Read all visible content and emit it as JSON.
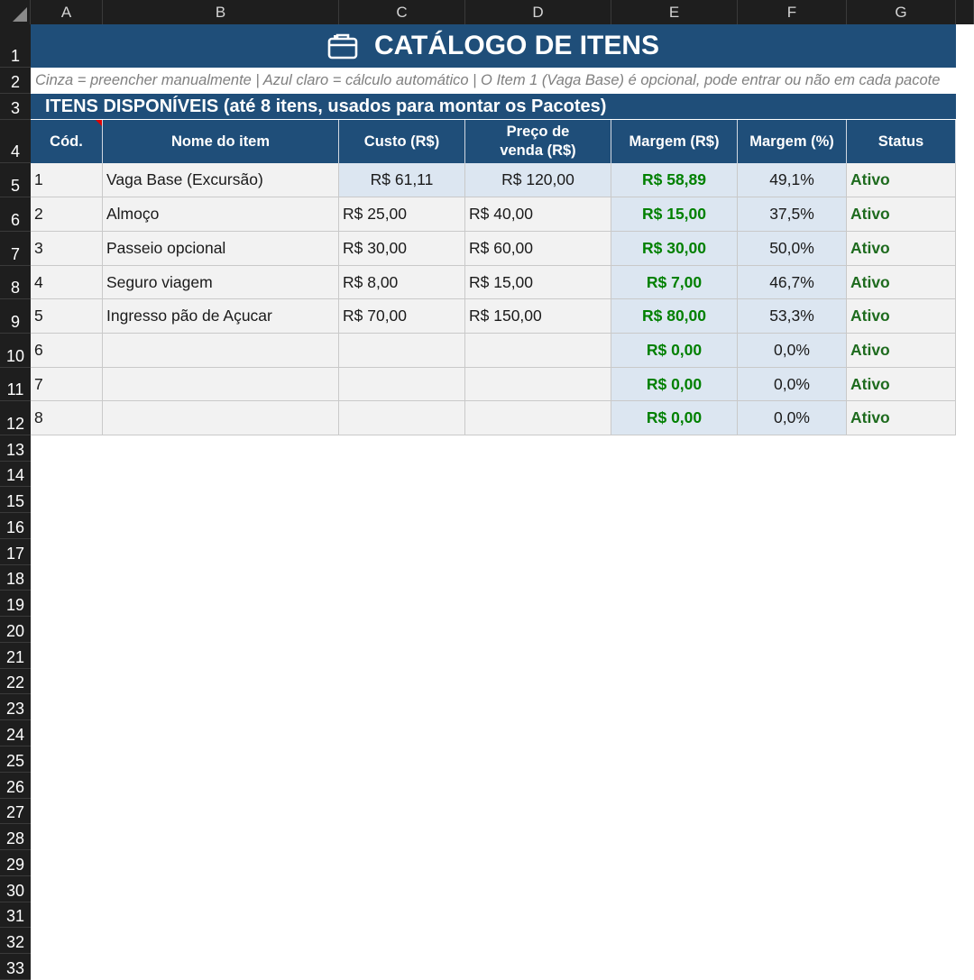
{
  "columns": [
    "A",
    "B",
    "C",
    "D",
    "E",
    "F",
    "G"
  ],
  "rows": [
    "1",
    "2",
    "3",
    "4",
    "5",
    "6",
    "7",
    "8",
    "9",
    "10",
    "11",
    "12",
    "13",
    "14",
    "15",
    "16",
    "17",
    "18",
    "19",
    "20",
    "21",
    "22",
    "23",
    "24",
    "25",
    "26",
    "27",
    "28",
    "29",
    "30",
    "31",
    "32",
    "33"
  ],
  "title": "CATÁLOGO DE ITENS",
  "title_icon": "briefcase-icon",
  "note": "Cinza = preencher manualmente   |   Azul claro = cálculo automático   |   O Item 1 (Vaga Base) é opcional, pode entrar ou não em cada pacote",
  "section_title": "ITENS DISPONÍVEIS (até 8 itens, usados para montar os Pacotes)",
  "headers": [
    "Cód.",
    "Nome do item",
    "Custo (R$)",
    "Preço de venda (R$)",
    "Margem (R$)",
    "Margem (%)",
    "Status"
  ],
  "items": [
    {
      "cod": "1",
      "nome": "Vaga Base (Excursão)",
      "custo": "R$ 61,11",
      "preco": "R$ 120,00",
      "margem": "R$ 58,89",
      "pct": "49,1%",
      "status": "Ativo"
    },
    {
      "cod": "2",
      "nome": "Almoço",
      "custo": "R$ 25,00",
      "preco": "R$ 40,00",
      "margem": "R$ 15,00",
      "pct": "37,5%",
      "status": "Ativo"
    },
    {
      "cod": "3",
      "nome": "Passeio opcional",
      "custo": "R$ 30,00",
      "preco": "R$ 60,00",
      "margem": "R$ 30,00",
      "pct": "50,0%",
      "status": "Ativo"
    },
    {
      "cod": "4",
      "nome": "Seguro viagem",
      "custo": "R$ 8,00",
      "preco": "R$ 15,00",
      "margem": "R$ 7,00",
      "pct": "46,7%",
      "status": "Ativo"
    },
    {
      "cod": "5",
      "nome": "Ingresso pão de Açucar",
      "custo": "R$ 70,00",
      "preco": "R$ 150,00",
      "margem": "R$ 80,00",
      "pct": "53,3%",
      "status": "Ativo"
    },
    {
      "cod": "6",
      "nome": "",
      "custo": "",
      "preco": "",
      "margem": "R$ 0,00",
      "pct": "0,0%",
      "status": "Ativo"
    },
    {
      "cod": "7",
      "nome": "",
      "custo": "",
      "preco": "",
      "margem": "R$ 0,00",
      "pct": "0,0%",
      "status": "Ativo"
    },
    {
      "cod": "8",
      "nome": "",
      "custo": "",
      "preco": "",
      "margem": "R$ 0,00",
      "pct": "0,0%",
      "status": "Ativo"
    }
  ],
  "colors": {
    "header_blue": "#1f4e79",
    "light_blue": "#dce6f1",
    "input_gray": "#f2f2f2",
    "margin_green": "#008000",
    "status_green": "#1e6b1e"
  }
}
